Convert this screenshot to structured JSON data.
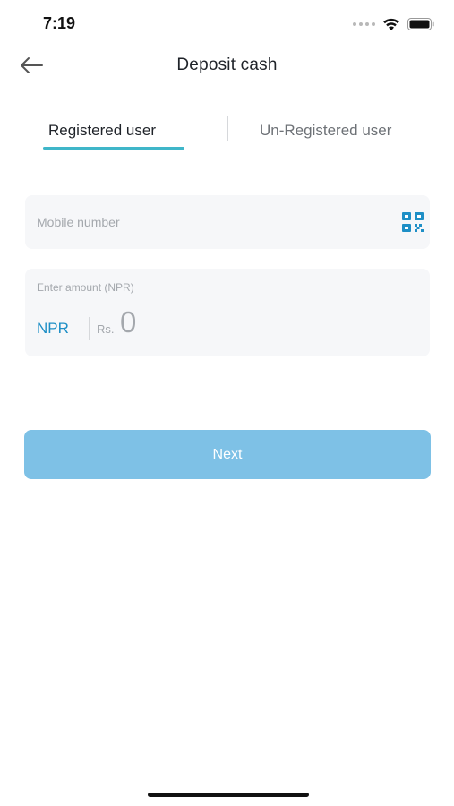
{
  "status_bar": {
    "time": "7:19"
  },
  "header": {
    "title": "Deposit cash",
    "back_icon": "arrow-left-icon"
  },
  "tabs": [
    {
      "label": "Registered user",
      "active": true
    },
    {
      "label": "Un-Registered user",
      "active": false
    }
  ],
  "mobile_field": {
    "placeholder": "Mobile number",
    "value": "",
    "icon": "qr-code-icon"
  },
  "amount_field": {
    "label": "Enter amount (NPR)",
    "currency_code": "NPR",
    "currency_symbol": "Rs.",
    "value": "0"
  },
  "next_button": {
    "label": "Next"
  },
  "colors": {
    "accent": "#1e8fc6",
    "tab_underline": "#3fb6c9",
    "button_bg": "#7ec1e6",
    "field_bg": "#f6f7f9"
  }
}
